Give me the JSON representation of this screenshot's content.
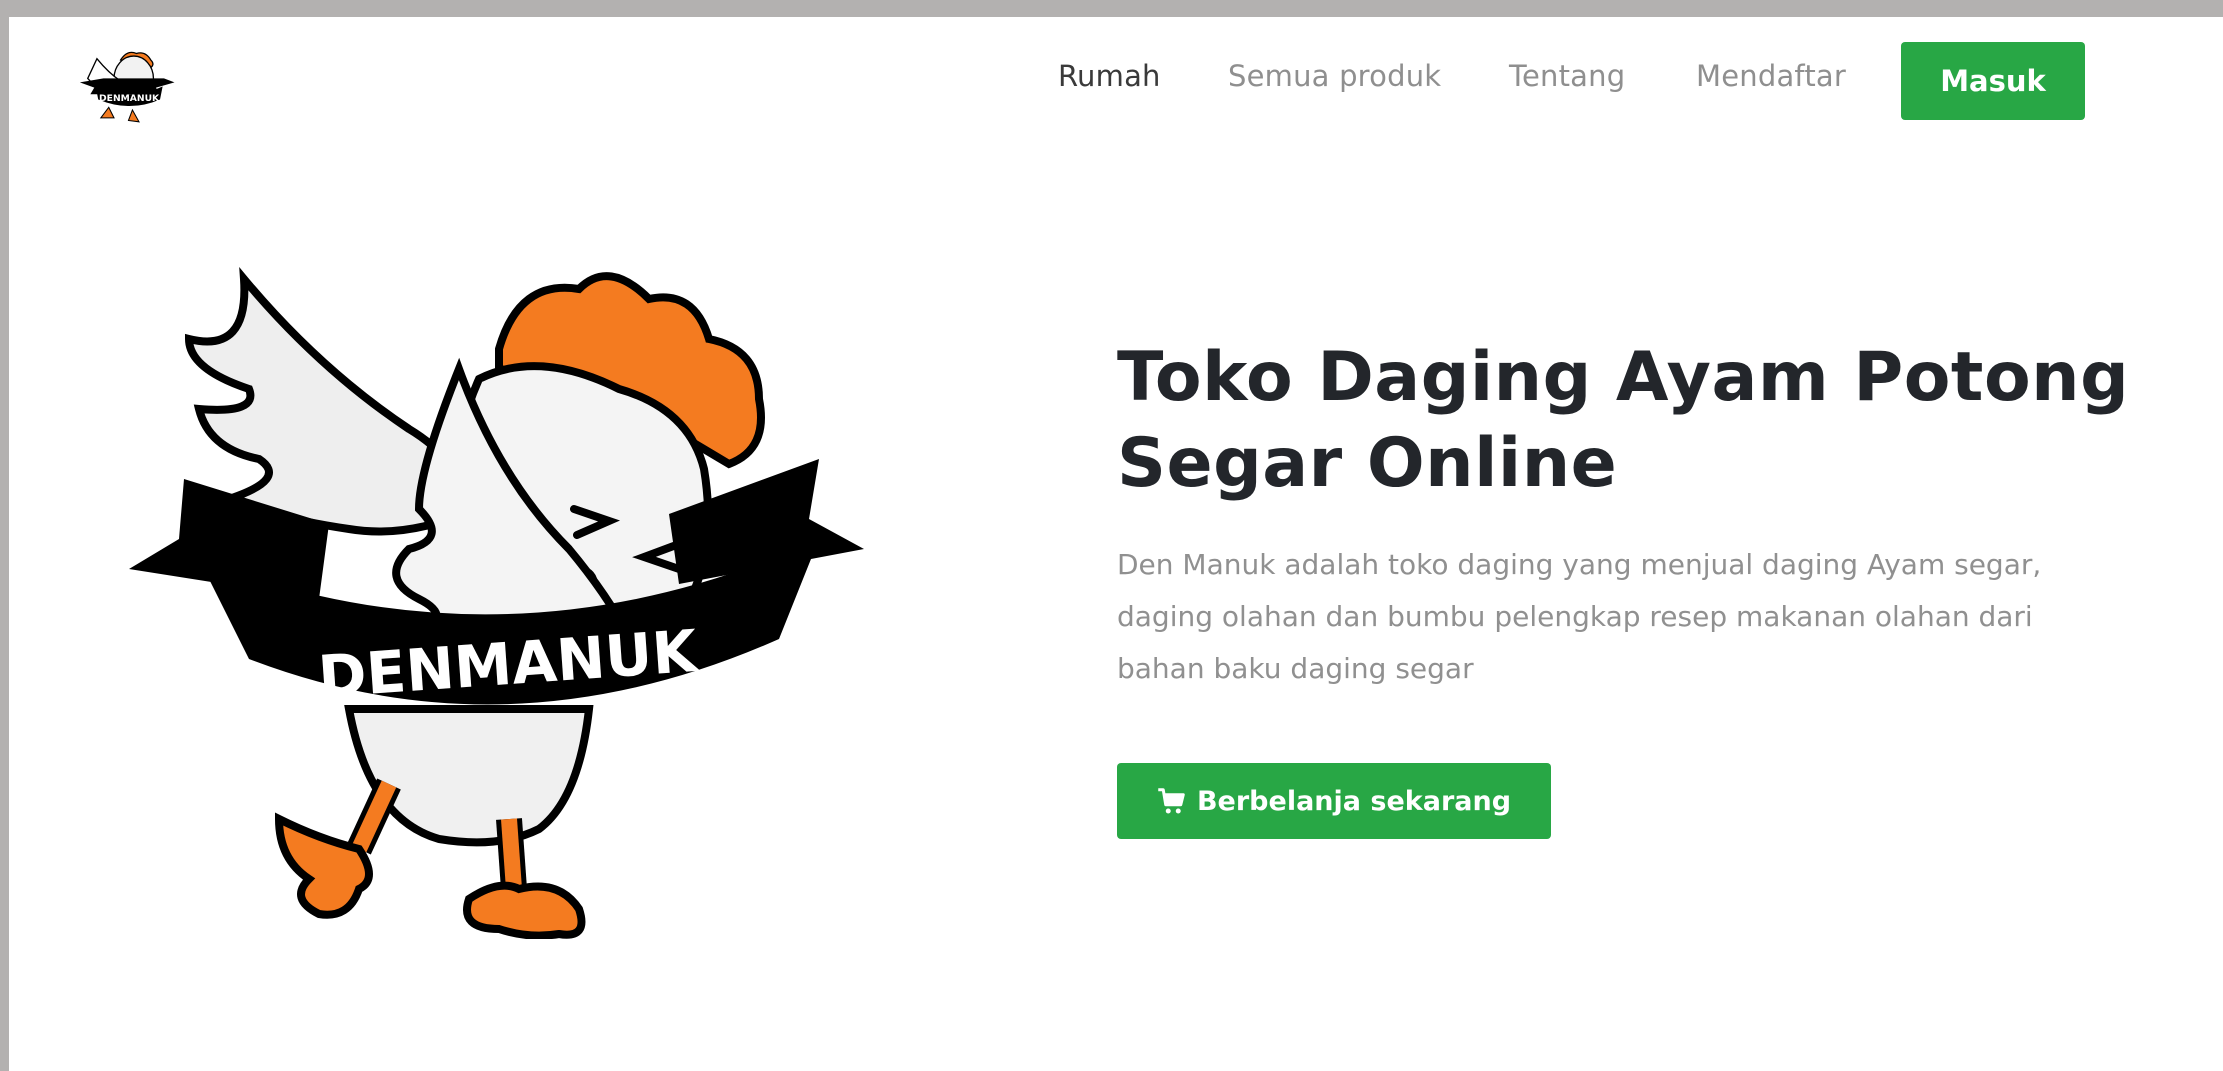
{
  "nav": {
    "logo_text": "DENMANUK",
    "links": [
      {
        "label": "Rumah",
        "active": true
      },
      {
        "label": "Semua produk",
        "active": false
      },
      {
        "label": "Tentang",
        "active": false
      },
      {
        "label": "Mendaftar",
        "active": false
      }
    ],
    "login_label": "Masuk"
  },
  "hero": {
    "logo_text": "DENMANUK",
    "title": "Toko Daging Ayam Potong Segar Online",
    "description": "Den Manuk adalah toko daging yang menjual daging Ayam segar, daging olahan dan bumbu pelengkap resep makanan olahan dari bahan baku daging segar",
    "cta_label": "Berbelanja sekarang",
    "cta_icon": "shopping-cart-icon"
  },
  "colors": {
    "accent": "#28a745",
    "title": "#23262b",
    "muted": "#909090",
    "chicken_orange": "#f47b20"
  }
}
